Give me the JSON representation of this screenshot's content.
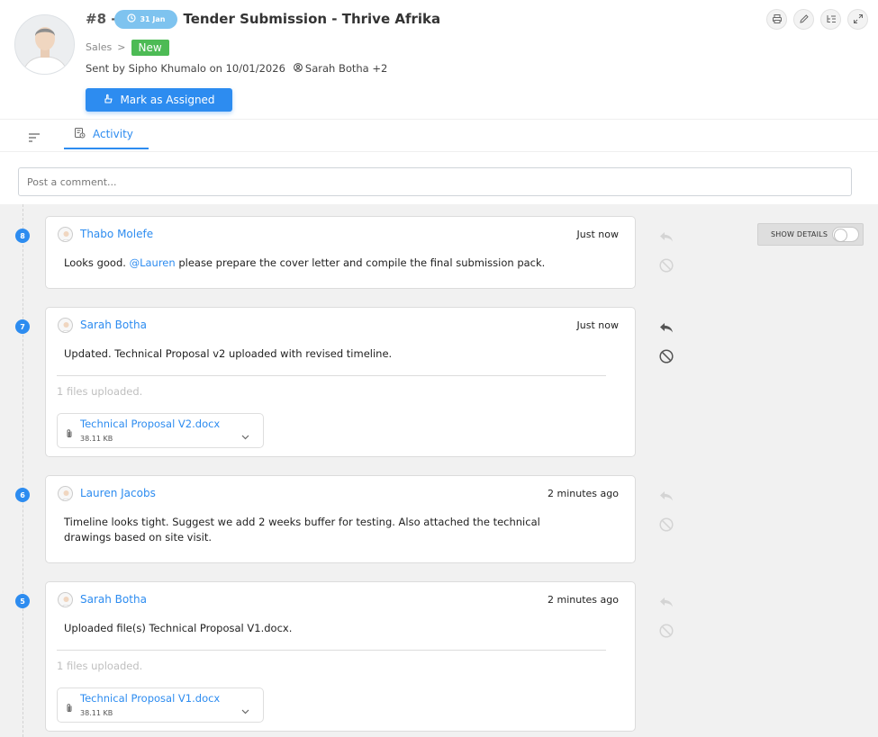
{
  "ticket": {
    "number": "#8 -",
    "date_pill": "31 Jan",
    "title": "Tender Submission - Thrive Afrika",
    "breadcrumb": "Sales",
    "breadcrumb_separator": ">",
    "status": "New",
    "status_color": "#4dbb55",
    "sent_by": "Sent by Sipho Khumalo on 10/01/2026",
    "assignees": "Sarah Botha +2",
    "assign_button": "Mark as Assigned"
  },
  "header_actions": [
    "printer-icon",
    "pencil-icon",
    "checklist-icon",
    "expand-icon"
  ],
  "tabs": {
    "filter_icon": "sort-lines-icon",
    "activity_label": "Activity"
  },
  "comment": {
    "placeholder": "Post a comment..."
  },
  "show_details": {
    "label": "SHOW DETAILS",
    "enabled": false
  },
  "feed": [
    {
      "step": "8",
      "author": "Thabo Molefe",
      "time": "Just now",
      "text_before": "Looks good.",
      "mention": "@Lauren",
      "text_after": "please prepare the cover letter and compile the final submission pack.",
      "actions_enabled": false
    },
    {
      "step": "7",
      "author": "Sarah Botha",
      "time": "Just now",
      "text": "Updated. Technical Proposal v2 uploaded with revised timeline.",
      "files_label": "1 files uploaded.",
      "file_name": "Technical Proposal V2.docx",
      "file_size": "38.11 KB",
      "actions_enabled": true
    },
    {
      "step": "6",
      "author": "Lauren Jacobs",
      "time": "2 minutes ago",
      "text_line1": "Timeline looks tight. Suggest we add 2 weeks buffer for testing. Also attached the technical",
      "text_line2": "drawings based on site visit.",
      "actions_enabled": false
    },
    {
      "step": "5",
      "author": "Sarah Botha",
      "time": "2 minutes ago",
      "text": "Uploaded file(s) Technical Proposal V1.docx.",
      "files_label": "1 files uploaded.",
      "file_name": "Technical Proposal V1.docx",
      "file_size": "38.11 KB",
      "actions_enabled": false
    }
  ],
  "colors": {
    "accent": "#2d8cf0",
    "date_pill": "#7ec3ef",
    "feed_background": "#f1f1f1"
  }
}
